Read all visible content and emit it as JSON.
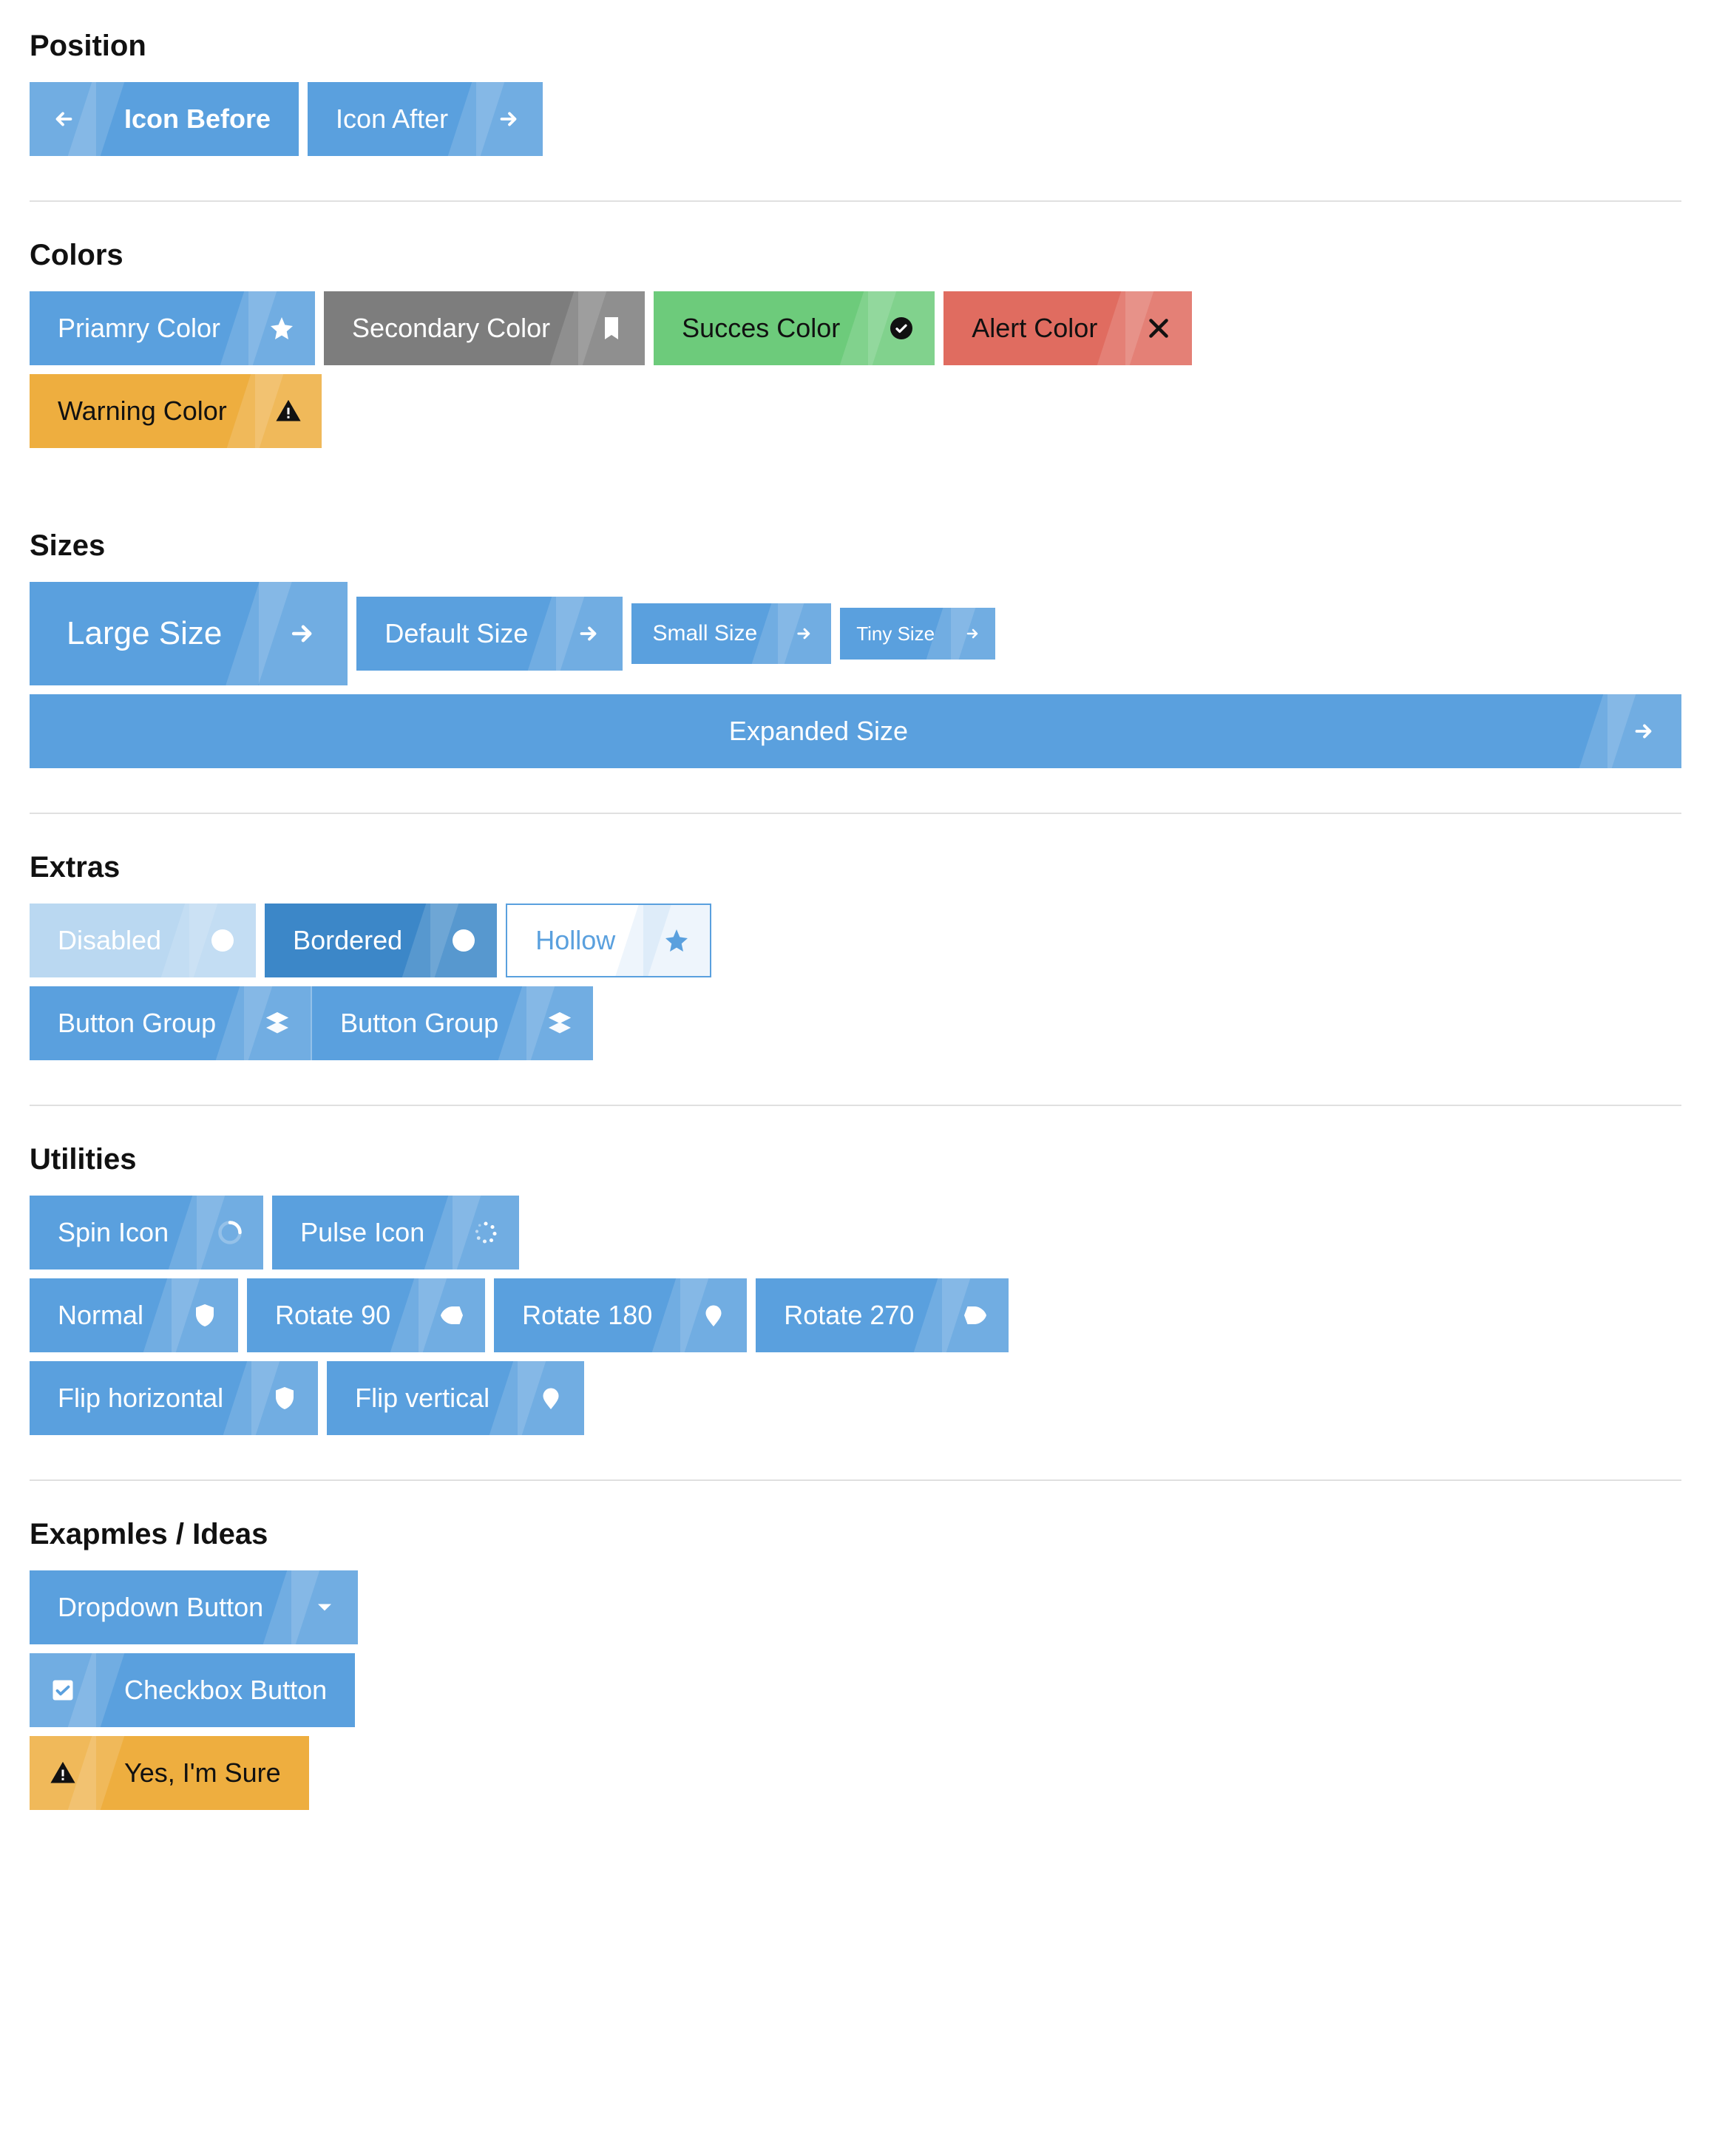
{
  "position": {
    "title": "Position",
    "icon_before": "Icon Before",
    "icon_after": "Icon After"
  },
  "colors": {
    "title": "Colors",
    "primary": "Priamry Color",
    "secondary": "Secondary Color",
    "success": "Succes Color",
    "alert": "Alert Color",
    "warning": "Warning Color"
  },
  "sizes": {
    "title": "Sizes",
    "large": "Large Size",
    "default": "Default Size",
    "small": "Small Size",
    "tiny": "Tiny Size",
    "expanded": "Expanded Size"
  },
  "extras": {
    "title": "Extras",
    "disabled": "Disabled",
    "bordered": "Bordered",
    "hollow": "Hollow",
    "group1": "Button Group",
    "group2": "Button Group"
  },
  "utilities": {
    "title": "Utilities",
    "spin": "Spin Icon",
    "pulse": "Pulse Icon",
    "normal": "Normal",
    "rotate90": "Rotate 90",
    "rotate180": "Rotate 180",
    "rotate270": "Rotate 270",
    "flip_h": "Flip horizontal",
    "flip_v": "Flip vertical"
  },
  "examples": {
    "title": "Exapmles / Ideas",
    "dropdown": "Dropdown Button",
    "checkbox": "Checkbox Button",
    "confirm": "Yes, I'm Sure"
  }
}
